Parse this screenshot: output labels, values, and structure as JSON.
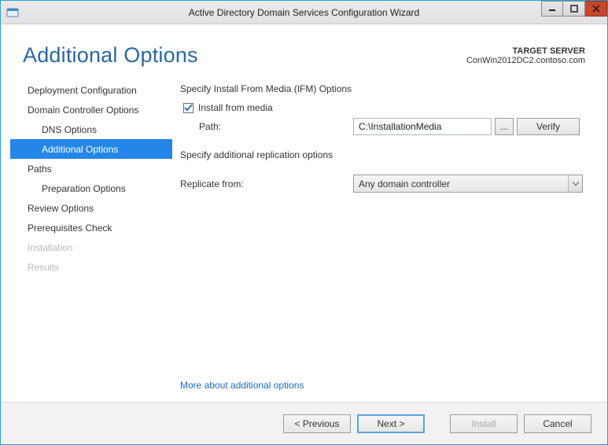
{
  "titlebar": {
    "title": "Active Directory Domain Services Configuration Wizard"
  },
  "header": {
    "page_title": "Additional Options",
    "target_label": "TARGET SERVER",
    "target_value": "ConWin2012DC2.contoso.com"
  },
  "nav": {
    "items": [
      {
        "label": "Deployment Configuration",
        "sub": false,
        "selected": false,
        "disabled": false
      },
      {
        "label": "Domain Controller Options",
        "sub": false,
        "selected": false,
        "disabled": false
      },
      {
        "label": "DNS Options",
        "sub": true,
        "selected": false,
        "disabled": false
      },
      {
        "label": "Additional Options",
        "sub": true,
        "selected": true,
        "disabled": false
      },
      {
        "label": "Paths",
        "sub": false,
        "selected": false,
        "disabled": false
      },
      {
        "label": "Preparation Options",
        "sub": true,
        "selected": false,
        "disabled": false
      },
      {
        "label": "Review Options",
        "sub": false,
        "selected": false,
        "disabled": false
      },
      {
        "label": "Prerequisites Check",
        "sub": false,
        "selected": false,
        "disabled": false
      },
      {
        "label": "Installation",
        "sub": false,
        "selected": false,
        "disabled": true
      },
      {
        "label": "Results",
        "sub": false,
        "selected": false,
        "disabled": true
      }
    ]
  },
  "main": {
    "ifm_heading": "Specify Install From Media (IFM) Options",
    "ifm_checkbox_label": "Install from media",
    "ifm_checked": true,
    "path_label": "Path:",
    "path_value": "C:\\InstallationMedia",
    "browse_label": "...",
    "verify_label": "Verify",
    "replication_heading": "Specify additional replication options",
    "replicate_label": "Replicate from:",
    "replicate_value": "Any domain controller",
    "more_link": "More about additional options"
  },
  "footer": {
    "previous": "< Previous",
    "next": "Next >",
    "install": "Install",
    "cancel": "Cancel"
  }
}
